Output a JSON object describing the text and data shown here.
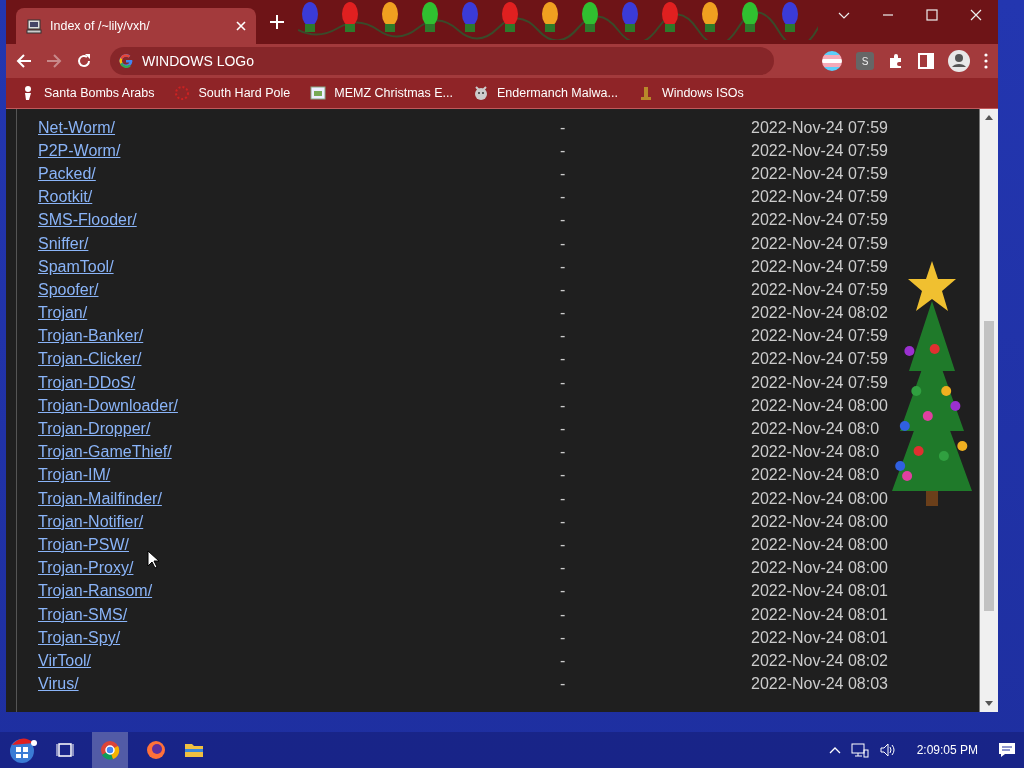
{
  "tab": {
    "title": "Index of /~lily/vxh/"
  },
  "toolbar": {
    "address": "WINDOWS LOGo",
    "forward": {
      "disabled": true
    },
    "extension_badge": "S"
  },
  "bookmarks": [
    {
      "label": "Santa Bombs Arabs"
    },
    {
      "label": "South Hard Pole"
    },
    {
      "label": "MEMZ Christmas E..."
    },
    {
      "label": "Endermanch Malwa..."
    },
    {
      "label": "Windows ISOs"
    }
  ],
  "listing": {
    "rows": [
      {
        "name": "Net-Worm/",
        "size": "-",
        "modified": "2022-Nov-24 07:59"
      },
      {
        "name": "P2P-Worm/",
        "size": "-",
        "modified": "2022-Nov-24 07:59"
      },
      {
        "name": "Packed/",
        "size": "-",
        "modified": "2022-Nov-24 07:59"
      },
      {
        "name": "Rootkit/",
        "size": "-",
        "modified": "2022-Nov-24 07:59"
      },
      {
        "name": "SMS-Flooder/",
        "size": "-",
        "modified": "2022-Nov-24 07:59"
      },
      {
        "name": "Sniffer/",
        "size": "-",
        "modified": "2022-Nov-24 07:59"
      },
      {
        "name": "SpamTool/",
        "size": "-",
        "modified": "2022-Nov-24 07:59"
      },
      {
        "name": "Spoofer/",
        "size": "-",
        "modified": "2022-Nov-24 07:59"
      },
      {
        "name": "Trojan/",
        "size": "-",
        "modified": "2022-Nov-24 08:02"
      },
      {
        "name": "Trojan-Banker/",
        "size": "-",
        "modified": "2022-Nov-24 07:59"
      },
      {
        "name": "Trojan-Clicker/",
        "size": "-",
        "modified": "2022-Nov-24 07:59"
      },
      {
        "name": "Trojan-DDoS/",
        "size": "-",
        "modified": "2022-Nov-24 07:59"
      },
      {
        "name": "Trojan-Downloader/",
        "size": "-",
        "modified": "2022-Nov-24 08:00"
      },
      {
        "name": "Trojan-Dropper/",
        "size": "-",
        "modified": "2022-Nov-24 08:0"
      },
      {
        "name": "Trojan-GameThief/",
        "size": "-",
        "modified": "2022-Nov-24 08:0"
      },
      {
        "name": "Trojan-IM/",
        "size": "-",
        "modified": "2022-Nov-24 08:0"
      },
      {
        "name": "Trojan-Mailfinder/",
        "size": "-",
        "modified": "2022-Nov-24 08:00"
      },
      {
        "name": "Trojan-Notifier/",
        "size": "-",
        "modified": "2022-Nov-24 08:00"
      },
      {
        "name": "Trojan-PSW/",
        "size": "-",
        "modified": "2022-Nov-24 08:00"
      },
      {
        "name": "Trojan-Proxy/",
        "size": "-",
        "modified": "2022-Nov-24 08:00"
      },
      {
        "name": "Trojan-Ransom/",
        "size": "-",
        "modified": "2022-Nov-24 08:01"
      },
      {
        "name": "Trojan-SMS/",
        "size": "-",
        "modified": "2022-Nov-24 08:01"
      },
      {
        "name": "Trojan-Spy/",
        "size": "-",
        "modified": "2022-Nov-24 08:01"
      },
      {
        "name": "VirTool/",
        "size": "-",
        "modified": "2022-Nov-24 08:02"
      },
      {
        "name": "Virus/",
        "size": "-",
        "modified": "2022-Nov-24 08:03"
      }
    ]
  },
  "taskbar": {
    "clock": "2:09:05 PM"
  }
}
